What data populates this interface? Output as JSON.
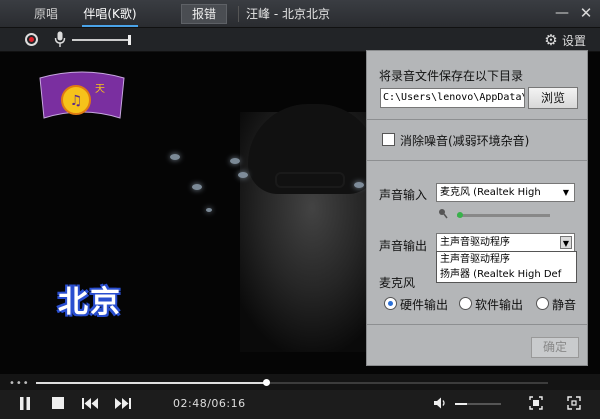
{
  "titlebar": {
    "tab_original": "原唱",
    "tab_accompaniment": "伴唱(K歌)",
    "report_error": "报错",
    "song_title": "汪峰 - 北京北京",
    "minimize_glyph": "—",
    "close_glyph": "✕"
  },
  "toolbar": {
    "mic_volume_level": 1.0,
    "settings_label": "设置"
  },
  "video": {
    "lyric_text": "北京",
    "logo_icon": "channel-logo"
  },
  "settings_panel": {
    "save_dir_label": "将录音文件保存在以下目录",
    "save_path": "C:\\Users\\lenovo\\AppData\\R",
    "browse_label": "浏览",
    "noise_reduction_label": "消除噪音(减弱环境杂音)",
    "noise_reduction_checked": false,
    "sound_input_label": "声音输入",
    "sound_input_value": "麦克风 (Realtek High",
    "input_level": 0.05,
    "sound_output_label": "声音输出",
    "sound_output_value": "主声音驱动程序",
    "output_options": [
      "主声音驱动程序",
      "扬声器 (Realtek High Def"
    ],
    "mic_label": "麦克风",
    "mic_modes": [
      {
        "label": "硬件输出",
        "selected": true
      },
      {
        "label": "软件输出",
        "selected": false
      },
      {
        "label": "静音",
        "selected": false
      }
    ],
    "ok_label": "确定",
    "ok_enabled": false
  },
  "player": {
    "progress_fraction": 0.45,
    "time_display": "02:48/06:16",
    "volume_level": 0.25,
    "seek_menu_glyph": "•••"
  },
  "colors": {
    "accent": "#4aa3e8",
    "record_red": "#e0242c",
    "panel_bg": "#b4b6b8",
    "lyric_outline": "#2a4fd0",
    "input_level_green": "#38b24a"
  }
}
